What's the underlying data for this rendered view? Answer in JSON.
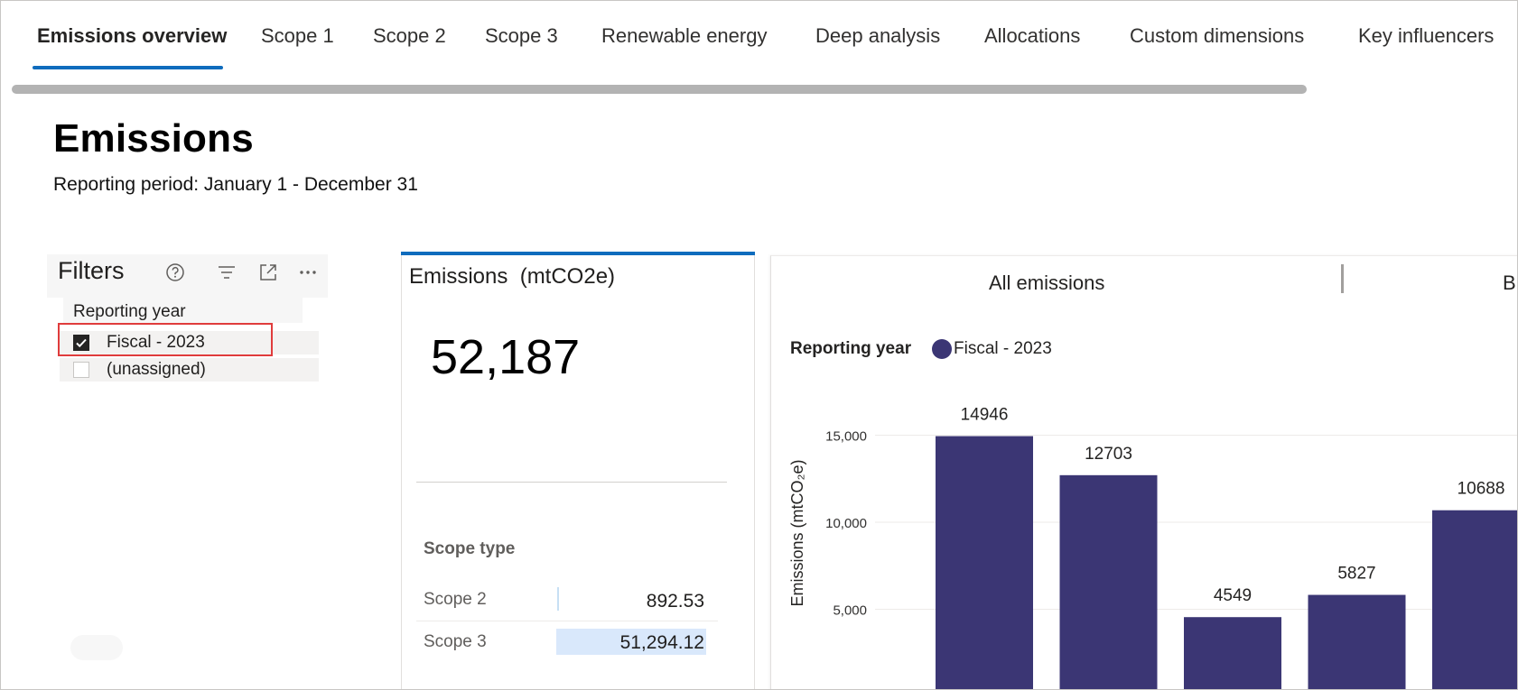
{
  "tabs": [
    {
      "label": "Emissions overview",
      "active": true
    },
    {
      "label": "Scope 1"
    },
    {
      "label": "Scope 2"
    },
    {
      "label": "Scope 3"
    },
    {
      "label": "Renewable energy"
    },
    {
      "label": "Deep analysis"
    },
    {
      "label": "Allocations"
    },
    {
      "label": "Custom dimensions"
    },
    {
      "label": "Key influencers"
    }
  ],
  "header": {
    "title": "Emissions",
    "period": "Reporting period: January 1 - December 31"
  },
  "filters": {
    "title": "Filters",
    "group_label": "Reporting year",
    "options": [
      {
        "label": "Fiscal - 2023",
        "checked": true
      },
      {
        "label": "(unassigned)",
        "checked": false
      }
    ],
    "icons": [
      "help-icon",
      "filter-icon",
      "expand-icon",
      "more-icon"
    ]
  },
  "card": {
    "title": "Emissions  (mtCO2e)",
    "total": "52,187",
    "scope_type_label": "Scope type",
    "rows": [
      {
        "label": "Scope 2",
        "value": "892.53"
      },
      {
        "label": "Scope 3",
        "value": "51,294.12"
      }
    ]
  },
  "chart_panel": {
    "tabs": [
      "All emissions",
      "B"
    ],
    "legend_title": "Reporting year",
    "legend_series": "Fiscal - 2023",
    "series_color": "#3b3674"
  },
  "chart_data": {
    "type": "bar",
    "ylabel": "Emissions (mtCO₂e)",
    "y_ticks": [
      "5,000",
      "10,000",
      "15,000"
    ],
    "series": [
      {
        "name": "Fiscal - 2023",
        "values": [
          14946,
          12703,
          4549,
          5827,
          10688
        ]
      }
    ],
    "data_labels": [
      "14946",
      "12703",
      "4549",
      "5827",
      "10688"
    ]
  },
  "colors": {
    "accent": "#0f6cbd",
    "highlight": "#e03c3c",
    "bar": "#3b3674"
  }
}
